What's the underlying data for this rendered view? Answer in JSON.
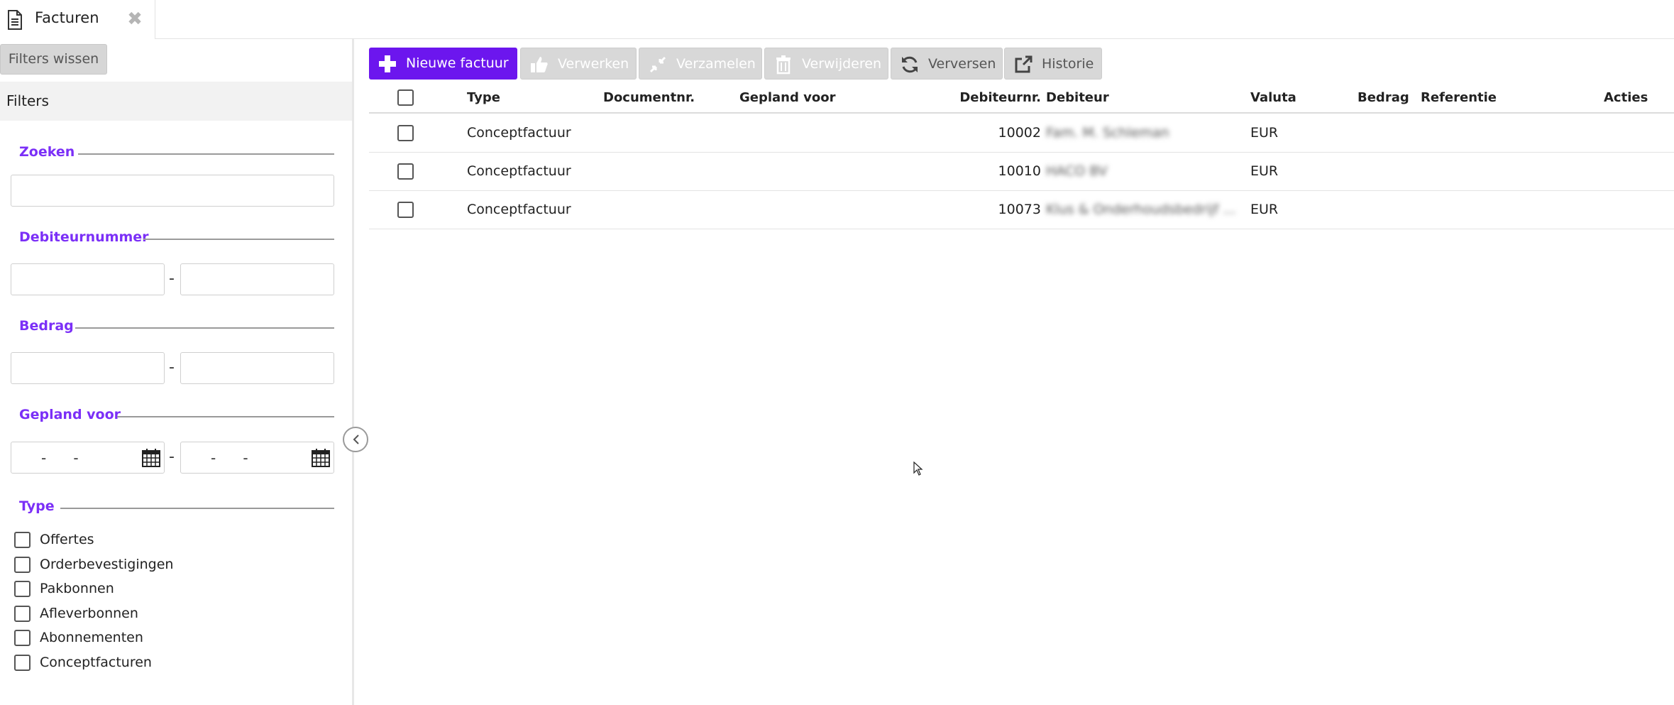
{
  "tab": {
    "label": "Facturen",
    "close_icon": "close-icon",
    "doc_icon": "document-icon"
  },
  "sidebar": {
    "clear_filters": "Filters wissen",
    "filters_title": "Filters",
    "sections": {
      "search": "Zoeken",
      "debtor_number": "Debiteurnummer",
      "amount": "Bedrag",
      "scheduled_for": "Gepland voor",
      "type": "Type"
    },
    "range_separator": "-",
    "date_placeholder": "-      -",
    "type_options": [
      "Offertes",
      "Orderbevestigingen",
      "Pakbonnen",
      "Afleverbonnen",
      "Abonnementen",
      "Conceptfacturen"
    ]
  },
  "toolbar": {
    "new_invoice": "Nieuwe factuur",
    "process": "Verwerken",
    "collect": "Verzamelen",
    "delete": "Verwijderen",
    "refresh": "Verversen",
    "history": "Historie"
  },
  "table": {
    "columns": {
      "type": "Type",
      "document_nr": "Documentnr.",
      "scheduled_for": "Gepland voor",
      "debtor_nr": "Debiteurnr.",
      "debtor": "Debiteur",
      "currency": "Valuta",
      "amount": "Bedrag",
      "reference": "Referentie",
      "actions": "Acties"
    },
    "rows": [
      {
        "type": "Conceptfactuur",
        "document_nr": "",
        "scheduled_for": "",
        "debtor_nr": "10002",
        "debtor": "Fam. M. Schleman",
        "currency": "EUR",
        "amount": "",
        "reference": ""
      },
      {
        "type": "Conceptfactuur",
        "document_nr": "",
        "scheduled_for": "",
        "debtor_nr": "10010",
        "debtor": "HACO BV",
        "currency": "EUR",
        "amount": "",
        "reference": ""
      },
      {
        "type": "Conceptfactuur",
        "document_nr": "",
        "scheduled_for": "",
        "debtor_nr": "10073",
        "debtor": "Klus & Onderhoudsbedrijf ...",
        "currency": "EUR",
        "amount": "",
        "reference": ""
      }
    ]
  },
  "colors": {
    "accent": "#6c16ee",
    "section_title": "#7b2ff7",
    "disabled_button": "#d8d8d8"
  }
}
